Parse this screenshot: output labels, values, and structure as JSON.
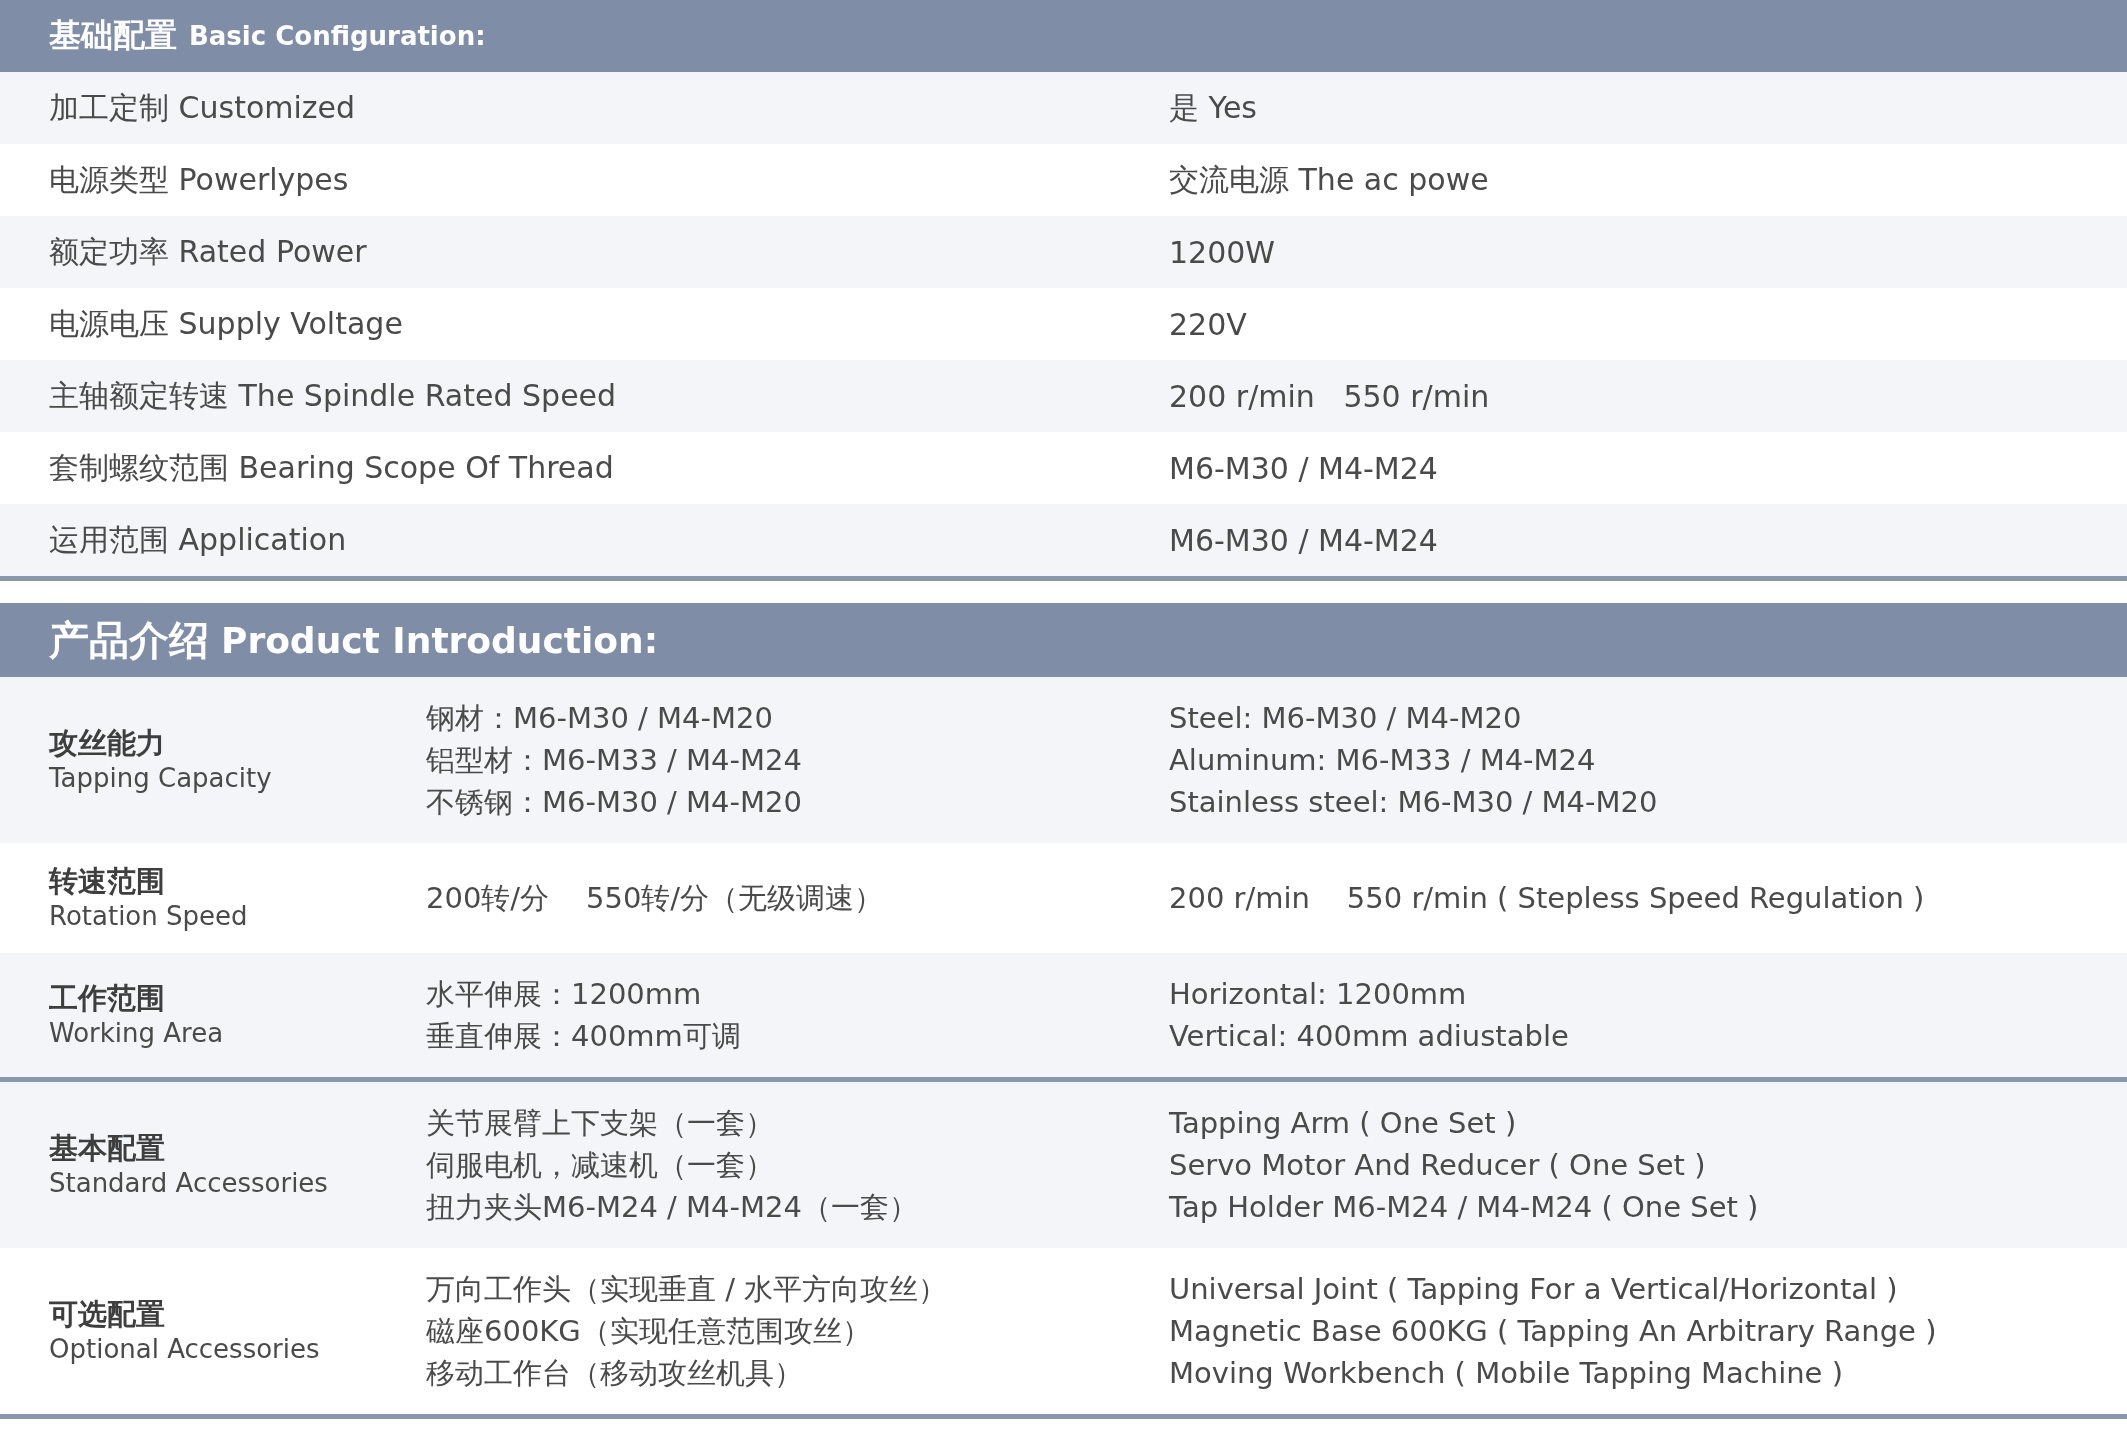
{
  "basic": {
    "title_cn": "基础配置",
    "title_en": "Basic Configuration:",
    "rows": [
      {
        "label": "加工定制 Customized",
        "value": "是 Yes"
      },
      {
        "label": "电源类型 Powerlypes",
        "value": "交流电源 The ac powe"
      },
      {
        "label": "额定功率 Rated Power",
        "value": "1200W"
      },
      {
        "label": "电源电压 Supply Voltage",
        "value": "220V"
      },
      {
        "label": "主轴额定转速 The Spindle Rated Speed",
        "value": "200 r/min   550 r/min"
      },
      {
        "label": "套制螺纹范围 Bearing Scope Of Thread",
        "value": "M6-M30 / M4-M24"
      },
      {
        "label": "运用范围 Application",
        "value": "M6-M30 / M4-M24"
      }
    ]
  },
  "intro": {
    "title_cn": "产品介绍",
    "title_en": "Product Introduction:",
    "groups": [
      {
        "rows": [
          {
            "name_cn": "攻丝能力",
            "name_en": "Tapping Capacity",
            "cn_lines": [
              "钢材：M6-M30 / M4-M20",
              "铝型材：M6-M33 / M4-M24",
              "不锈钢：M6-M30 / M4-M20"
            ],
            "en_lines": [
              "Steel: M6-M30 / M4-M20",
              "Aluminum: M6-M33 / M4-M24",
              "Stainless steel: M6-M30 / M4-M20"
            ]
          },
          {
            "name_cn": "转速范围",
            "name_en": "Rotation Speed",
            "cn_lines": [
              "200转/分    550转/分（无级调速）"
            ],
            "en_lines": [
              "200 r/min    550 r/min ( Stepless Speed Regulation )"
            ]
          },
          {
            "name_cn": "工作范围",
            "name_en": "Working Area",
            "cn_lines": [
              "水平伸展：1200mm",
              "垂直伸展：400mm可调"
            ],
            "en_lines": [
              "Horizontal: 1200mm",
              "Vertical: 400mm adiustable"
            ]
          }
        ]
      },
      {
        "rows": [
          {
            "name_cn": "基本配置",
            "name_en": "Standard Accessories",
            "cn_lines": [
              "关节展臂上下支架（一套）",
              "伺服电机，减速机（一套）",
              "扭力夹头M6-M24 / M4-M24（一套）"
            ],
            "en_lines": [
              "Tapping Arm ( One Set )",
              "Servo Motor And Reducer ( One Set )",
              "Tap Holder M6-M24 / M4-M24 ( One Set )"
            ]
          },
          {
            "name_cn": "可选配置",
            "name_en": "Optional Accessories",
            "cn_lines": [
              "万向工作头（实现垂直 / 水平方向攻丝）",
              "磁座600KG（实现任意范围攻丝）",
              "移动工作台（移动攻丝机具）"
            ],
            "en_lines": [
              "Universal Joint ( Tapping For a Vertical/Horizontal )",
              "Magnetic Base 600KG ( Tapping An Arbitrary Range )",
              "Moving Workbench ( Mobile Tapping Machine )"
            ]
          }
        ]
      }
    ]
  }
}
